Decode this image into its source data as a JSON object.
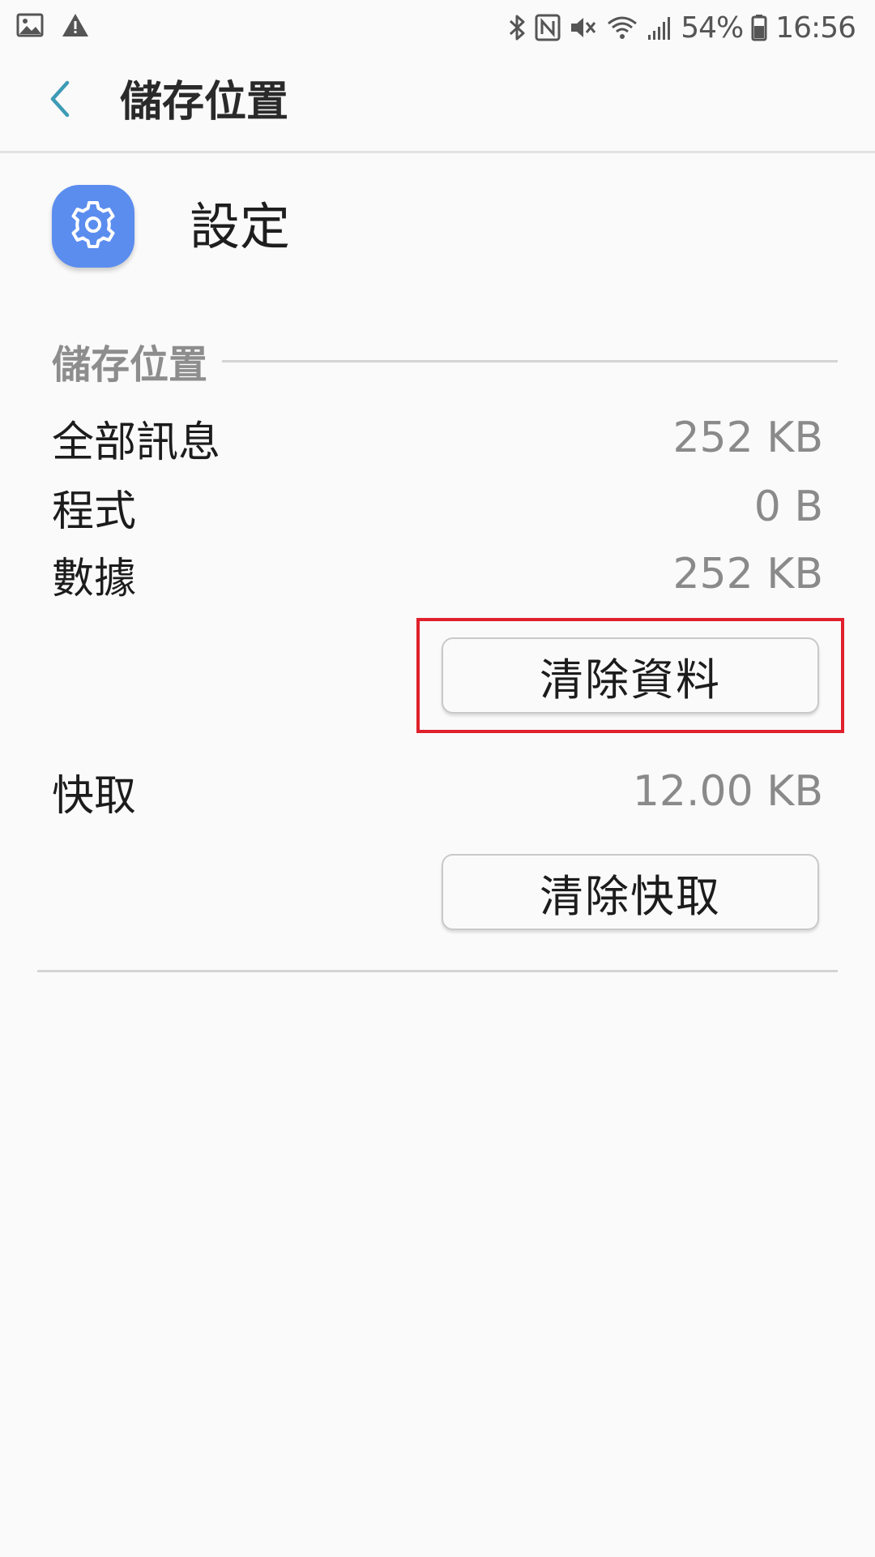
{
  "status_bar": {
    "left_icons": [
      "image-icon",
      "warning-icon"
    ],
    "right_icons": [
      "bluetooth-icon",
      "nfc-icon",
      "mute-icon",
      "wifi-icon",
      "signal-icon"
    ],
    "battery_percent": "54%",
    "time": "16:56"
  },
  "app_bar": {
    "title": "儲存位置",
    "back_icon": "chevron-left-icon"
  },
  "app": {
    "name": "設定",
    "icon": "gear-icon",
    "icon_color": "#5b8def"
  },
  "storage": {
    "section_title": "儲存位置",
    "rows": [
      {
        "label": "全部訊息",
        "value": "252 KB"
      },
      {
        "label": "程式",
        "value": "0 B"
      },
      {
        "label": "數據",
        "value": "252 KB"
      }
    ],
    "clear_data_label": "清除資料"
  },
  "cache": {
    "label": "快取",
    "value": "12.00 KB",
    "clear_cache_label": "清除快取"
  },
  "colors": {
    "background": "#fafafa",
    "accent": "#3e9bb5",
    "highlight": "#e0202c"
  }
}
